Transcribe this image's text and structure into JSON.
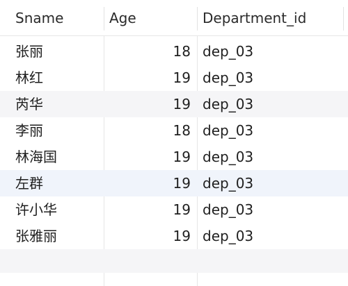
{
  "table": {
    "columns": [
      "Sname",
      "Age",
      "Department_id"
    ],
    "rows": [
      {
        "sname": "张丽",
        "age": "18",
        "department_id": "dep_03"
      },
      {
        "sname": "林红",
        "age": "19",
        "department_id": "dep_03"
      },
      {
        "sname": "芮华",
        "age": "19",
        "department_id": "dep_03"
      },
      {
        "sname": "李丽",
        "age": "18",
        "department_id": "dep_03"
      },
      {
        "sname": "林海国",
        "age": "19",
        "department_id": "dep_03"
      },
      {
        "sname": "左群",
        "age": "19",
        "department_id": "dep_03"
      },
      {
        "sname": "许小华",
        "age": "19",
        "department_id": "dep_03"
      },
      {
        "sname": "张雅丽",
        "age": "19",
        "department_id": "dep_03"
      }
    ],
    "colors": {
      "row_alt": "#f5f5f7",
      "row_selected": "#f0f4fb",
      "grid_line": "#e6e6e6"
    }
  }
}
